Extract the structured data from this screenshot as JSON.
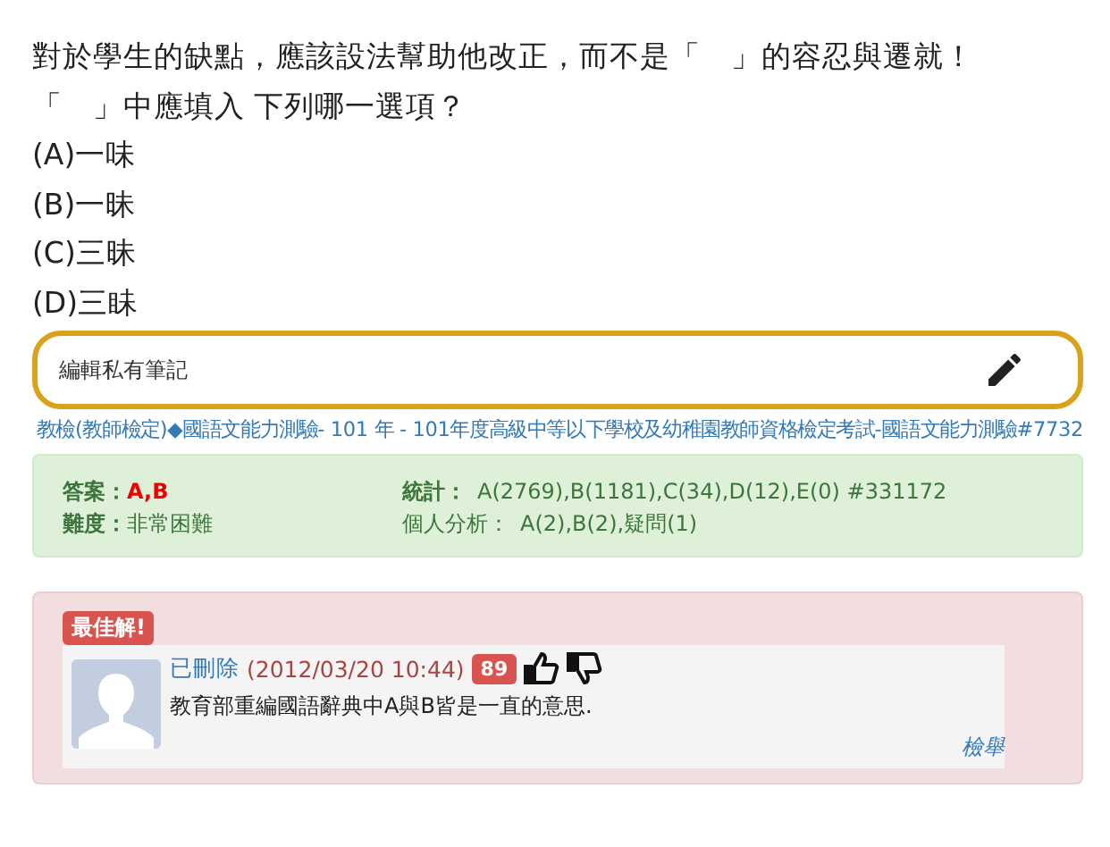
{
  "question": {
    "text": "對於學生的缺點，應該設法幫助他改正，而不是「　」的容忍與遷就！「　」中應填入 下列哪一選項？",
    "options": [
      "(A)一味",
      "(B)一昧",
      "(C)三昧",
      "(D)三眛"
    ]
  },
  "note_field": {
    "placeholder": "編輯私有筆記"
  },
  "source_link": "教檢(教師檢定)◆國語文能力測驗- 101 年 - 101年度高級中等以下學校及幼稚園教師資格檢定考試-國語文能力測驗#7732",
  "stats": {
    "answer_label": "答案：",
    "answer": "A,B",
    "difficulty_label": "難度：",
    "difficulty": "非常困難",
    "stats_label": "統計：",
    "stats": "A(2769),B(1181),C(34),D(12),E(0) #331172",
    "personal_label": "個人分析：",
    "personal": "A(2),B(2),疑問(1)"
  },
  "best_answer": {
    "badge": "最佳解!",
    "author": "已刪除",
    "time": "(2012/03/20 10:44)",
    "score": "89",
    "text": "教育部重編國語辭典中A與B皆是一直的意思.",
    "report": "檢舉"
  }
}
